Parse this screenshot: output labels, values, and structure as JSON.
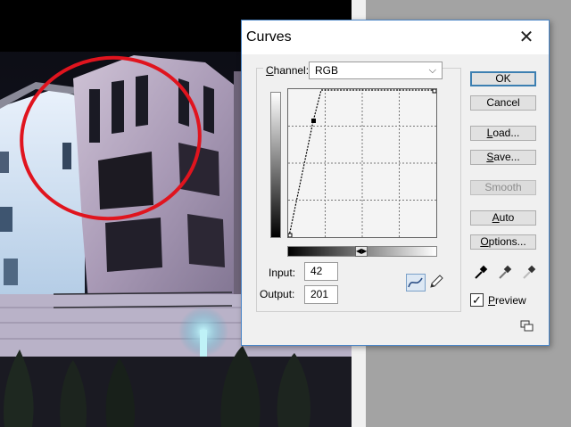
{
  "dialog": {
    "title": "Curves",
    "close_glyph": "✕"
  },
  "channel": {
    "label_u": "C",
    "label_rest": "hannel:",
    "value": "RGB",
    "chevron": "⌵"
  },
  "input": {
    "label": "Input:",
    "value": "42"
  },
  "output": {
    "label": "Output:",
    "value": "201"
  },
  "buttons": {
    "ok": "OK",
    "cancel": "Cancel",
    "load_u": "L",
    "load_rest": "oad...",
    "save_u": "S",
    "save_rest": "ave...",
    "smooth": "Smooth",
    "auto_u": "A",
    "auto_rest": "uto",
    "options_u": "O",
    "options_rest": "ptions..."
  },
  "preview": {
    "label_u": "P",
    "label_rest": "review",
    "checked": "✓"
  },
  "slider_glyph": "◀▶",
  "icons": {
    "curve_tool": "curve-point-icon",
    "pencil_tool": "pencil-icon",
    "black_eyedropper": "black-point-eyedropper-icon",
    "gray_eyedropper": "gray-point-eyedropper-icon",
    "white_eyedropper": "white-point-eyedropper-icon"
  },
  "colors": {
    "accent": "#3c7fb1",
    "annotation_circle": "#e0141e"
  }
}
